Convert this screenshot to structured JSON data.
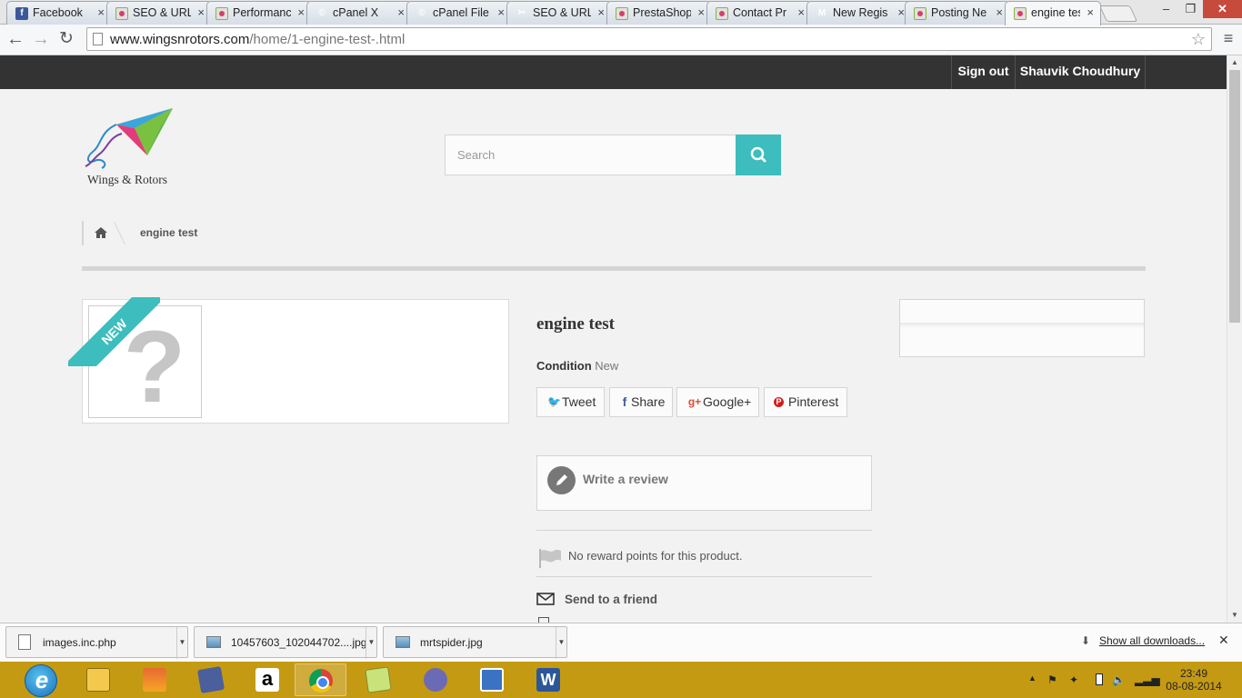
{
  "browser": {
    "tabs": [
      {
        "title": "Facebook",
        "icon": "facebook-icon",
        "active": false
      },
      {
        "title": "SEO & URL",
        "icon": "prestashop-icon",
        "active": false
      },
      {
        "title": "Performance",
        "icon": "prestashop-icon",
        "active": false
      },
      {
        "title": "cPanel X",
        "icon": "cpanel-icon",
        "active": false
      },
      {
        "title": "cPanel File",
        "icon": "cpanel-icon",
        "active": false
      },
      {
        "title": "SEO & URL",
        "icon": "tools-icon",
        "active": false
      },
      {
        "title": "PrestaShop",
        "icon": "prestashop-icon",
        "active": false
      },
      {
        "title": "Contact Pr",
        "icon": "prestashop-icon",
        "active": false
      },
      {
        "title": "New Regis",
        "icon": "gmail-icon",
        "active": false
      },
      {
        "title": "Posting Ne",
        "icon": "prestashop-icon",
        "active": false
      },
      {
        "title": "engine tes",
        "icon": "prestashop-icon",
        "active": true
      }
    ],
    "tab_close_glyph": "×",
    "window_controls": {
      "minimize": "–",
      "maximize": "❐",
      "close": "✕"
    },
    "url_host": "www.wingsnrotors.com",
    "url_path": "/home/1-engine-test-.html",
    "nav": {
      "back": "←",
      "forward": "→",
      "reload": "↻",
      "star": "☆",
      "menu": "≡"
    }
  },
  "page": {
    "topbar": {
      "sign_out": "Sign out",
      "user_name": "Shauvik Choudhury"
    },
    "logo_text": "Wings & Rotors",
    "search": {
      "placeholder": "Search"
    },
    "breadcrumb": {
      "current": "engine test"
    },
    "product": {
      "badge": "NEW",
      "title": "engine test",
      "condition_label": "Condition",
      "condition_value": "New",
      "share": [
        {
          "label": "Tweet",
          "icon": "twitter-icon",
          "glyph": "🐦",
          "color": "#00aaf0"
        },
        {
          "label": "Share",
          "icon": "facebook-icon",
          "glyph": "f",
          "color": "#435f9f"
        },
        {
          "label": "Google+",
          "icon": "google-plus-icon",
          "glyph": "g+",
          "color": "#e04a39"
        },
        {
          "label": "Pinterest",
          "icon": "pinterest-icon",
          "glyph": "P",
          "color": "#ce1f21"
        }
      ],
      "write_review": "Write a review",
      "reward_text": "No reward points for this product.",
      "send_to_friend": "Send to a friend"
    },
    "accent_color": "#3dbdbd"
  },
  "downloads": {
    "items": [
      {
        "name": "images.inc.php",
        "type": "file"
      },
      {
        "name": "10457603_102044702....jpg",
        "type": "image"
      },
      {
        "name": "mrtspider.jpg",
        "type": "image"
      }
    ],
    "show_all": "Show all downloads...",
    "close_glyph": "✕"
  },
  "taskbar": {
    "apps": [
      "internet-explorer",
      "file-explorer",
      "photo-gallery",
      "media-player",
      "amazon",
      "chrome",
      "folders",
      "tool-app",
      "maze-app",
      "word"
    ],
    "clock_time": "23:49",
    "clock_date": "08-08-2014"
  }
}
